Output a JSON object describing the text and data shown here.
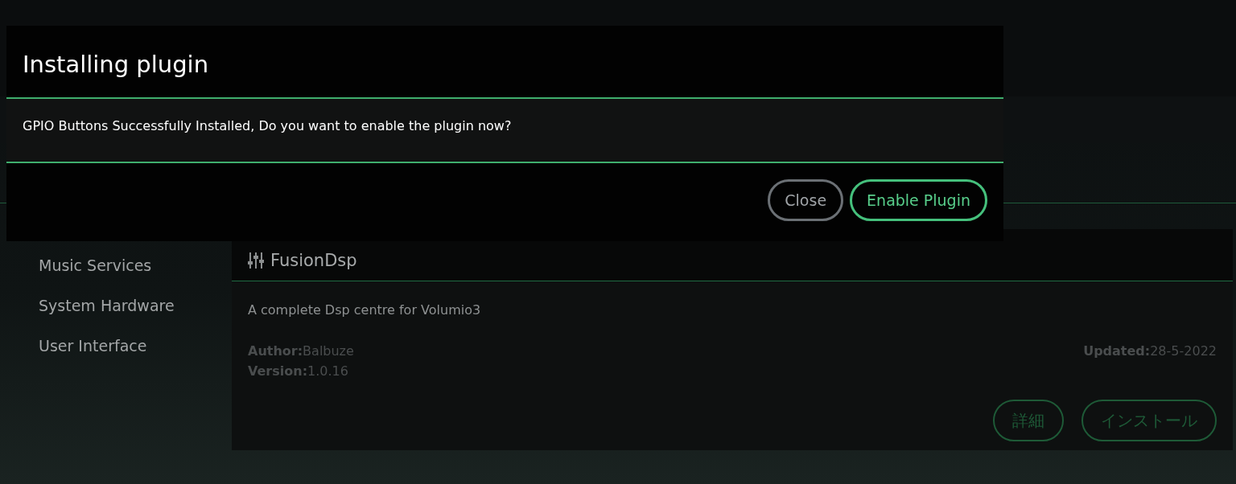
{
  "sidebar": {
    "items": [
      "Music Services",
      "System Hardware",
      "User Interface"
    ]
  },
  "plugin": {
    "name": "FusionDsp",
    "description": "A complete Dsp centre for Volumio3",
    "author_label": "Author:",
    "author": "Balbuze",
    "version_label": "Version:",
    "version": "1.0.16",
    "updated_label": "Updated:",
    "updated": "28-5-2022",
    "buttons": [
      "詳細",
      "インストール"
    ]
  },
  "dialog": {
    "title": "Installing plugin",
    "message": "GPIO Buttons Successfully Installed, Do you want to enable the plugin now?",
    "buttons": [
      {
        "label": "Close",
        "kind": "secondary"
      },
      {
        "label": "Enable Plugin",
        "kind": "primary"
      }
    ]
  }
}
